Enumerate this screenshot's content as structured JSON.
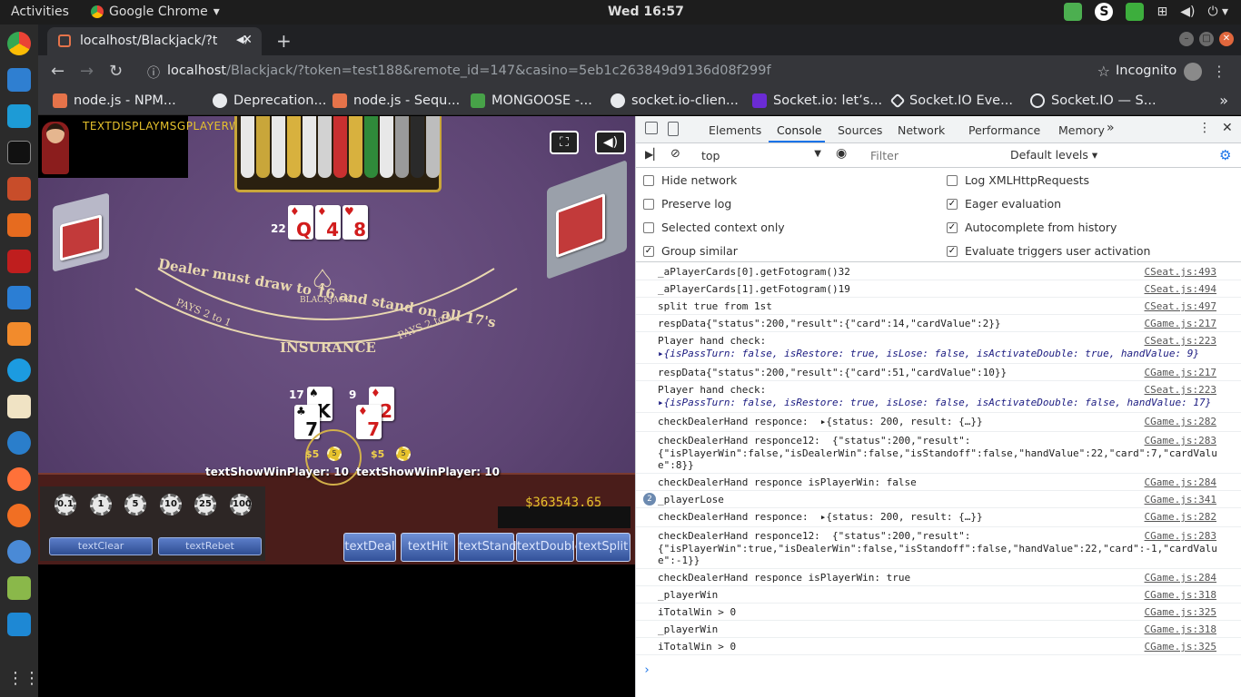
{
  "topbar": {
    "activities": "Activities",
    "app_name": "Google Chrome",
    "clock": "Wed 16:57"
  },
  "browser": {
    "tab_title": "localhost/Blackjack/?t",
    "url_host": "localhost",
    "url_path": "/Blackjack/?token=test188&remote_id=147&casino=5eb1c263849d9136d08f299f",
    "incognito": "Incognito",
    "bookmarks": [
      "node.js - NPM...",
      "Deprecation...",
      "node.js - Sequ...",
      "MONGOOSE -...",
      "socket.io-clien...",
      "Socket.io: let’s...",
      "Socket.IO Eve...",
      "Socket.IO — S..."
    ]
  },
  "game": {
    "msg_player_win": "TEXTDISPLAYMSGPLAYERWIN",
    "dealer": {
      "hand_value": "22",
      "cards": [
        {
          "rank": "Q",
          "suit": "♦"
        },
        {
          "rank": "4",
          "suit": "♦"
        },
        {
          "rank": "8",
          "suit": "♥"
        }
      ]
    },
    "felt": {
      "logo": "BLACKJACK",
      "rule": "Dealer must draw to 16 and stand on all 17's",
      "pays_left": "PAYS 2 to 1",
      "pays_right": "PAYS 2 to 1",
      "insurance": "INSURANCE"
    },
    "hands": [
      {
        "value": "17",
        "cards": [
          {
            "rank": "7",
            "suit": "♣"
          },
          {
            "rank": "K",
            "suit": "♠"
          }
        ],
        "bet": "$5",
        "chip": "5",
        "win_label": "textShowWinPlayer: 10"
      },
      {
        "value": "9",
        "cards": [
          {
            "rank": "7",
            "suit": "♦"
          },
          {
            "rank": "2",
            "suit": "♦"
          }
        ],
        "bet": "$5",
        "chip": "5",
        "win_label": "textShowWinPlayer: 10"
      }
    ],
    "chips": [
      "0.1",
      "1",
      "5",
      "10",
      "25",
      "100"
    ],
    "clear_label": "textClear",
    "rebet_label": "textRebet",
    "balance": "$363543.65",
    "actions": [
      "textDeal",
      "textHit",
      "textStand",
      "textDouble",
      "textSplit"
    ]
  },
  "devtools": {
    "tabs": [
      "Elements",
      "Console",
      "Sources",
      "Network",
      "Performance",
      "Memory"
    ],
    "context": "top",
    "filter_placeholder": "Filter",
    "levels": "Default levels",
    "settings": [
      {
        "label": "Hide network",
        "checked": false
      },
      {
        "label": "Log XMLHttpRequests",
        "checked": false
      },
      {
        "label": "Preserve log",
        "checked": false
      },
      {
        "label": "Eager evaluation",
        "checked": true
      },
      {
        "label": "Selected context only",
        "checked": false
      },
      {
        "label": "Autocomplete from history",
        "checked": true
      },
      {
        "label": "Group similar",
        "checked": true
      },
      {
        "label": "Evaluate triggers user activation",
        "checked": true
      }
    ],
    "logs": [
      {
        "msg": "_aPlayerCards[0].getFotogram()32",
        "src": "CSeat.js:493"
      },
      {
        "msg": "_aPlayerCards[1].getFotogram()19",
        "src": "CSeat.js:494"
      },
      {
        "msg": "split true from 1st",
        "src": "CSeat.js:497"
      },
      {
        "msg": "respData{\"status\":200,\"result\":{\"card\":14,\"cardValue\":2}}",
        "src": "CGame.js:217"
      },
      {
        "msg": "Player hand check:",
        "src": "CSeat.js:223",
        "obj": "▸{isPassTurn: false, isRestore: true, isLose: false, isActivateDouble: true, handValue: 9}"
      },
      {
        "msg": "respData{\"status\":200,\"result\":{\"card\":51,\"cardValue\":10}}",
        "src": "CGame.js:217"
      },
      {
        "msg": "Player hand check:",
        "src": "CSeat.js:223",
        "obj": "▸{isPassTurn: false, isRestore: true, isLose: false, isActivateDouble: false, handValue: 17}"
      },
      {
        "msg": "checkDealerHand responce:  ▸{status: 200, result: {…}}",
        "src": "CGame.js:282"
      },
      {
        "msg": "checkDealerHand responce12:  {\"status\":200,\"result\":",
        "src": "CGame.js:283",
        "l2": "{\"isPlayerWin\":false,\"isDealerWin\":false,\"isStandoff\":false,\"handValue\":22,\"card\":7,\"cardValu",
        "l3": "e\":8}}"
      },
      {
        "msg": "checkDealerHand responce isPlayerWin: false",
        "src": "CGame.js:284"
      },
      {
        "msg": "_playerLose",
        "src": "CGame.js:341",
        "count": "2"
      },
      {
        "msg": "checkDealerHand responce:  ▸{status: 200, result: {…}}",
        "src": "CGame.js:282"
      },
      {
        "msg": "checkDealerHand responce12:  {\"status\":200,\"result\":",
        "src": "CGame.js:283",
        "l2": "{\"isPlayerWin\":true,\"isDealerWin\":false,\"isStandoff\":false,\"handValue\":22,\"card\":-1,\"cardValu",
        "l3": "e\":-1}}"
      },
      {
        "msg": "checkDealerHand responce isPlayerWin: true",
        "src": "CGame.js:284"
      },
      {
        "msg": "_playerWin",
        "src": "CGame.js:318"
      },
      {
        "msg": "iTotalWin > 0",
        "src": "CGame.js:325"
      },
      {
        "msg": "_playerWin",
        "src": "CGame.js:318"
      },
      {
        "msg": "iTotalWin > 0",
        "src": "CGame.js:325"
      }
    ],
    "prompt": "›"
  }
}
